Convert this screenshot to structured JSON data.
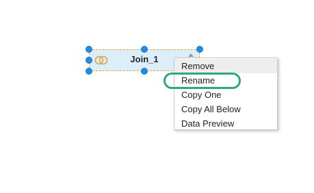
{
  "node": {
    "label": "Join_1",
    "icon": "join-icon",
    "border_color": "#e8a535",
    "fill_color": "#ddeefb",
    "handle_color": "#1e8de6"
  },
  "context_menu": {
    "items": [
      {
        "label": "Remove"
      },
      {
        "label": "Rename"
      },
      {
        "label": "Copy One"
      },
      {
        "label": "Copy All Below"
      },
      {
        "label": "Data Preview"
      }
    ],
    "highlighted_item": "Rename",
    "highlight_color": "#2aa787"
  }
}
